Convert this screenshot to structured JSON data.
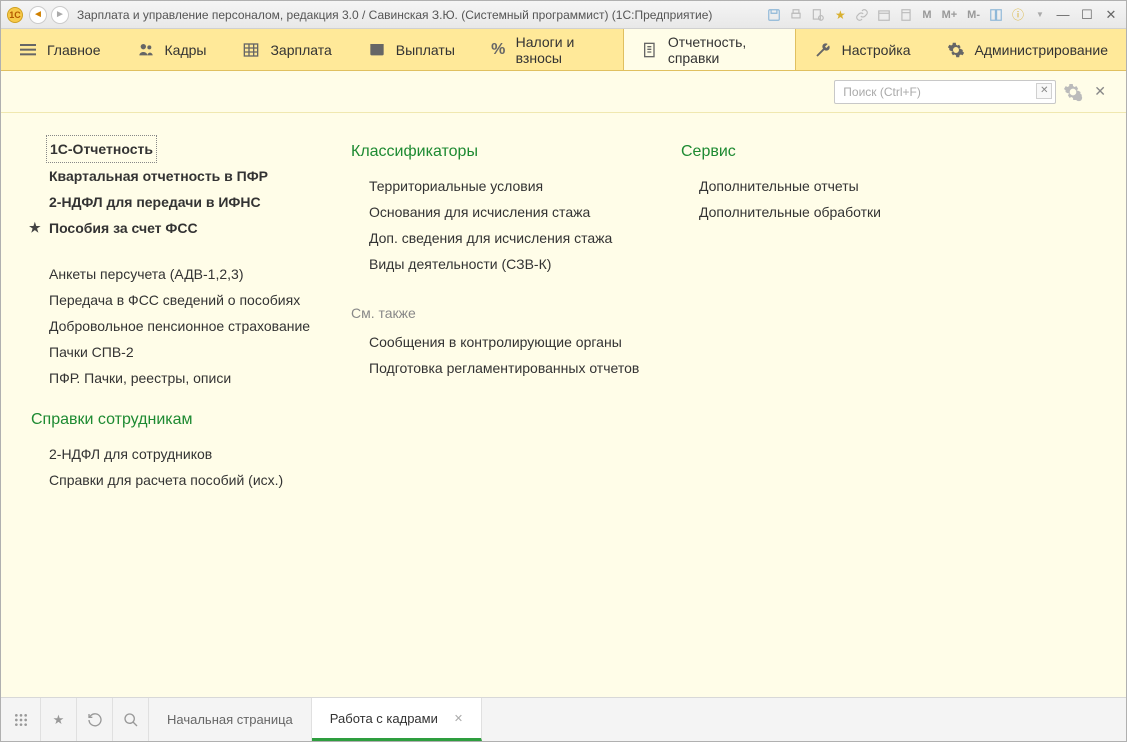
{
  "titlebar": {
    "logo_text": "1C",
    "title": "Зарплата и управление персоналом, редакция 3.0 / Савинская З.Ю. (Системный программист)  (1С:Предприятие)"
  },
  "topmenu": {
    "items": [
      {
        "label": "Главное"
      },
      {
        "label": "Кадры"
      },
      {
        "label": "Зарплата"
      },
      {
        "label": "Выплаты"
      },
      {
        "label": "Налоги и взносы"
      },
      {
        "label": "Отчетность, справки"
      },
      {
        "label": "Настройка"
      },
      {
        "label": "Администрирование"
      }
    ]
  },
  "search": {
    "placeholder": "Поиск (Ctrl+F)"
  },
  "col1": {
    "group1": {
      "items": [
        "1С-Отчетность",
        "Квартальная отчетность в ПФР",
        "2-НДФЛ для передачи в ИФНС",
        "Пособия за счет ФСС"
      ]
    },
    "group2": {
      "items": [
        "Анкеты персучета (АДВ-1,2,3)",
        "Передача в ФСС сведений о пособиях",
        "Добровольное пенсионное страхование",
        "Пачки СПВ-2",
        "ПФР. Пачки, реестры, описи"
      ]
    },
    "section2_title": "Справки сотрудникам",
    "group3": {
      "items": [
        "2-НДФЛ для сотрудников",
        "Справки для расчета пособий (исх.)"
      ]
    }
  },
  "col2": {
    "section_title": "Классификаторы",
    "group1": {
      "items": [
        "Территориальные условия",
        "Основания для исчисления стажа",
        "Доп. сведения для исчисления стажа",
        "Виды деятельности (СЗВ-К)"
      ]
    },
    "see_also_label": "См. также",
    "group2": {
      "items": [
        "Сообщения в контролирующие органы",
        "Подготовка регламентированных отчетов"
      ]
    }
  },
  "col3": {
    "section_title": "Сервис",
    "group1": {
      "items": [
        "Дополнительные отчеты",
        "Дополнительные обработки"
      ]
    }
  },
  "bottombar": {
    "tab1": "Начальная страница",
    "tab2": "Работа с кадрами"
  }
}
